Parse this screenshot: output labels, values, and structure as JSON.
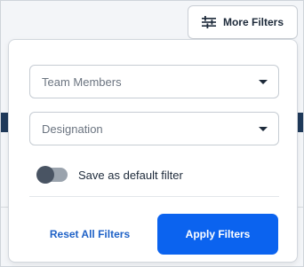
{
  "more_filters_button": {
    "label": "More Filters",
    "icon": "sliders-icon"
  },
  "filter_panel": {
    "team_members_select": {
      "label": "Team Members"
    },
    "designation_select": {
      "label": "Designation"
    },
    "default_toggle": {
      "label": "Save as default filter",
      "checked": false
    },
    "reset_button": {
      "label": "Reset All Filters"
    },
    "apply_button": {
      "label": "Apply Filters"
    }
  },
  "colors": {
    "primary": "#0b63ef",
    "link": "#1f62c7",
    "text": "#1d2a3a",
    "placeholder": "#6b7480"
  }
}
